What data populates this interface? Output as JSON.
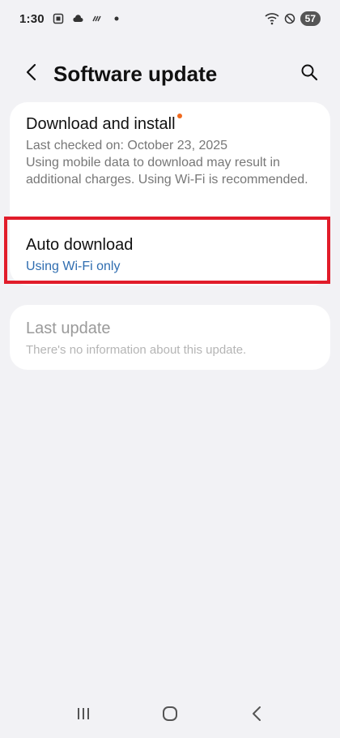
{
  "status_bar": {
    "time": "1:30",
    "battery": "57",
    "icons_left": [
      "screenshot-icon",
      "cloud-icon",
      "weather-icon",
      "dot-icon"
    ],
    "icons_right": [
      "wifi-icon",
      "do-not-disturb-icon",
      "battery-icon"
    ]
  },
  "header": {
    "title": "Software update",
    "back_icon": "back-arrow-icon",
    "search_icon": "search-icon"
  },
  "items": {
    "download_install": {
      "title": "Download and install",
      "subtitle": "Last checked on: October 23, 2025\nUsing mobile data to download may result in additional charges. Using Wi-Fi is recommended."
    },
    "auto_download": {
      "title": "Auto download",
      "subtitle": "Using Wi-Fi only"
    },
    "last_update": {
      "title": "Last update",
      "subtitle": "There's no information about this update."
    }
  },
  "colors": {
    "accent_blue": "#2f6db0",
    "notification_dot": "#f06a1e",
    "highlight_red": "#e11c2a",
    "background": "#f2f2f5"
  },
  "nav_bar": {
    "icons": [
      "recents-icon",
      "home-icon",
      "back-icon"
    ]
  }
}
